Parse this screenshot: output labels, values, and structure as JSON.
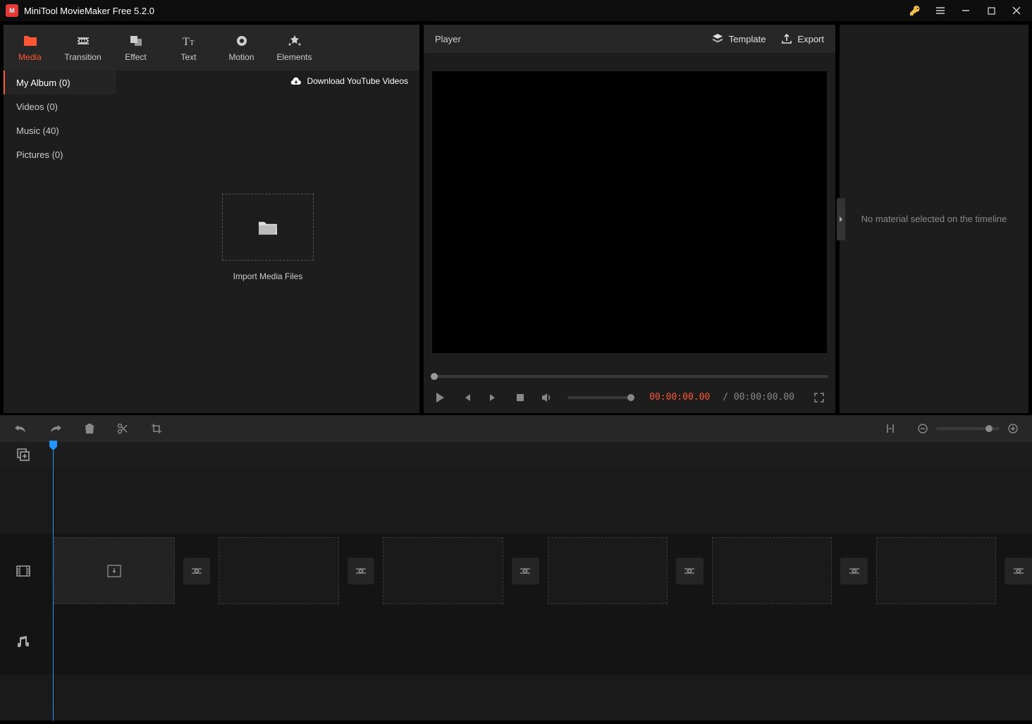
{
  "titlebar": {
    "title": "MiniTool MovieMaker Free 5.2.0"
  },
  "tabs": [
    {
      "id": "media",
      "label": "Media",
      "active": true
    },
    {
      "id": "transition",
      "label": "Transition",
      "active": false
    },
    {
      "id": "effect",
      "label": "Effect",
      "active": false
    },
    {
      "id": "text",
      "label": "Text",
      "active": false
    },
    {
      "id": "motion",
      "label": "Motion",
      "active": false
    },
    {
      "id": "elements",
      "label": "Elements",
      "active": false
    }
  ],
  "mediaSidebar": [
    {
      "id": "album",
      "label": "My Album (0)",
      "active": true
    },
    {
      "id": "videos",
      "label": "Videos (0)",
      "active": false
    },
    {
      "id": "music",
      "label": "Music (40)",
      "active": false
    },
    {
      "id": "pictures",
      "label": "Pictures (0)",
      "active": false
    }
  ],
  "downloadYT": "Download YouTube Videos",
  "importMedia": "Import Media Files",
  "player": {
    "title": "Player",
    "template": "Template",
    "export": "Export",
    "timeCurrent": "00:00:00.00",
    "timeTotal": "/ 00:00:00.00"
  },
  "rightPanel": {
    "noMaterial": "No material selected on the timeline"
  }
}
